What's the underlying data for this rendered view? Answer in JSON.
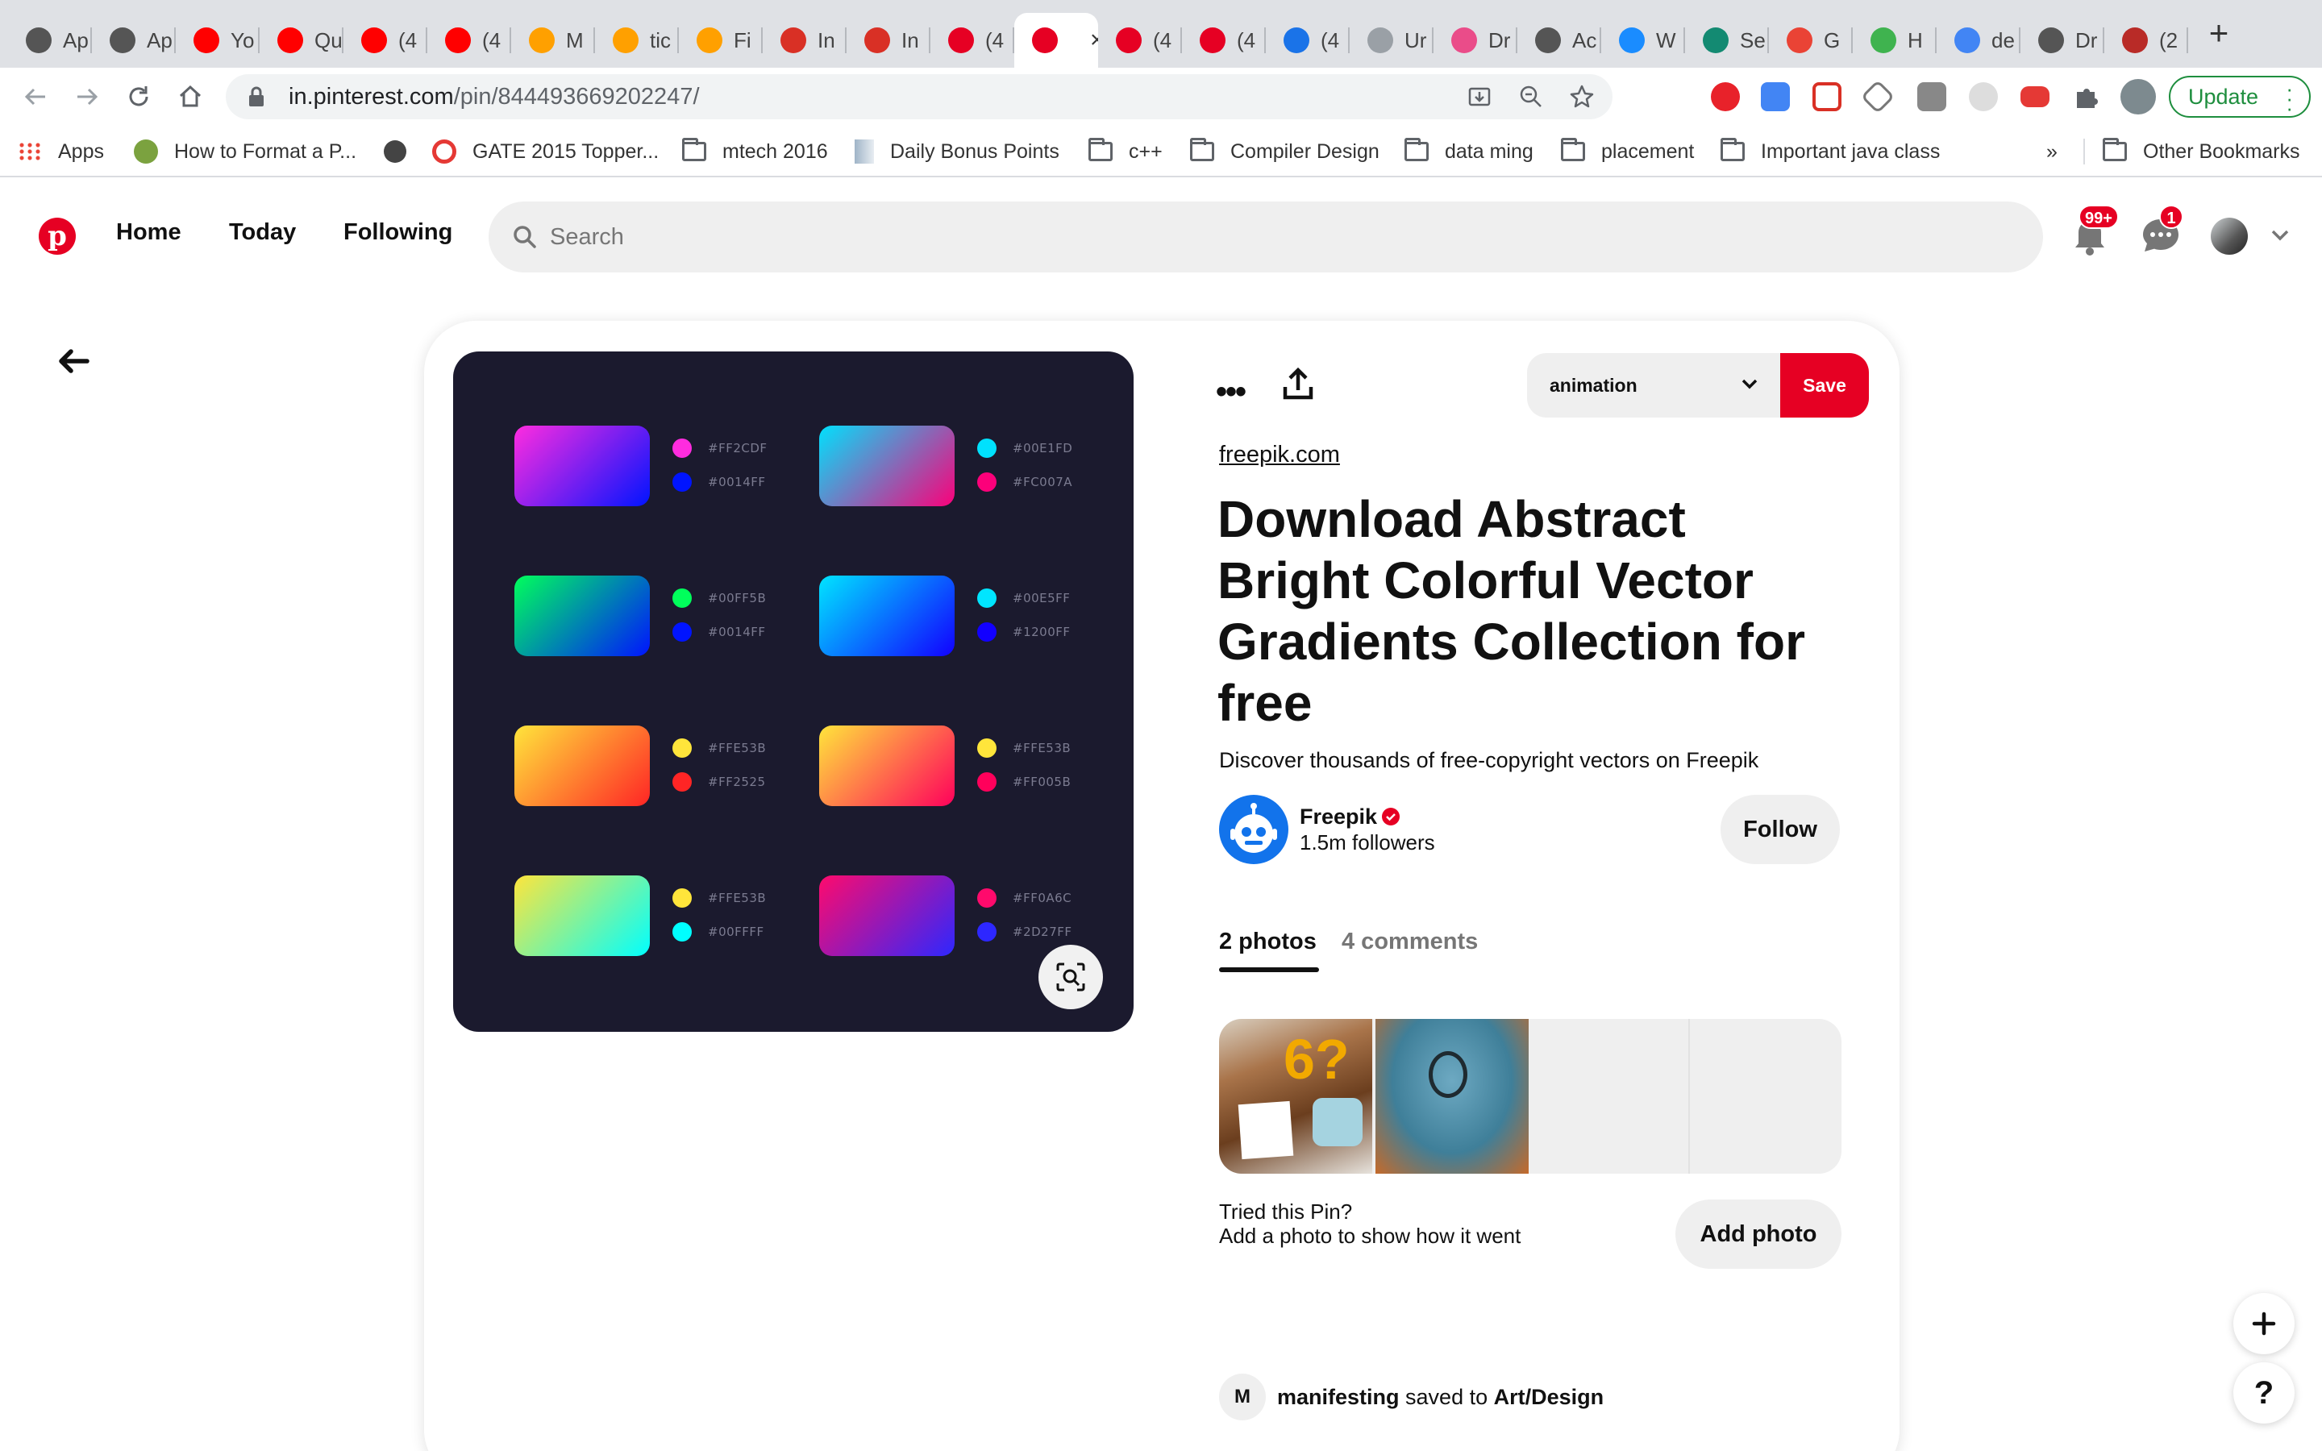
{
  "browser": {
    "tabs": [
      {
        "label": "Ap",
        "icon": "apple-icon",
        "color": "#555555"
      },
      {
        "label": "Ap",
        "icon": "apple-icon",
        "color": "#555555"
      },
      {
        "label": "Yo",
        "icon": "youtube-icon",
        "color": "#ff0000"
      },
      {
        "label": "Qu",
        "icon": "youtube-icon",
        "color": "#ff0000"
      },
      {
        "label": "(4",
        "icon": "youtube-icon",
        "color": "#ff0000"
      },
      {
        "label": "(4",
        "icon": "youtube-icon",
        "color": "#ff0000"
      },
      {
        "label": "M",
        "icon": "firebase-icon",
        "color": "#ffa000"
      },
      {
        "label": "tic",
        "icon": "firebase-icon",
        "color": "#ffa000"
      },
      {
        "label": "Fi",
        "icon": "firebase-icon",
        "color": "#ffa000"
      },
      {
        "label": "In",
        "icon": "gmail-icon",
        "color": "#d93025"
      },
      {
        "label": "In",
        "icon": "gmail-icon",
        "color": "#d93025"
      },
      {
        "label": "(4",
        "icon": "pinterest-icon",
        "color": "#e60023"
      },
      {
        "label": "",
        "icon": "pinterest-icon",
        "color": "#e60023",
        "active": true
      },
      {
        "label": "(4",
        "icon": "pinterest-icon",
        "color": "#e60023"
      },
      {
        "label": "(4",
        "icon": "pinterest-icon",
        "color": "#e60023"
      },
      {
        "label": "(4",
        "icon": "loading-icon",
        "color": "#1a73e8"
      },
      {
        "label": "Ur",
        "icon": "loading-icon",
        "color": "#9aa0a6"
      },
      {
        "label": "Dr",
        "icon": "dribbble-icon",
        "color": "#ea4c89"
      },
      {
        "label": "Ac",
        "icon": "fb-icon",
        "color": "#555555"
      },
      {
        "label": "W",
        "icon": "appstore-icon",
        "color": "#1a8cff"
      },
      {
        "label": "Se",
        "icon": "globe-icon",
        "color": "#138a72"
      },
      {
        "label": "G",
        "icon": "google-icon",
        "color": "#ea4335"
      },
      {
        "label": "H",
        "icon": "h-icon",
        "color": "#3fb34f"
      },
      {
        "label": "de",
        "icon": "google-icon",
        "color": "#4285f4"
      },
      {
        "label": "Dr",
        "icon": "apple-icon",
        "color": "#555555"
      },
      {
        "label": "(2",
        "icon": "quora-icon",
        "color": "#b92b27"
      }
    ],
    "url_domain": "in.pinterest.com",
    "url_path": "/pin/844493669202247/",
    "update_label": "Update",
    "bookmarks": [
      {
        "label": "Apps",
        "icon": "apps-grid-icon"
      },
      {
        "label": "How to Format a P...",
        "icon": "wh-icon"
      },
      {
        "label": "",
        "icon": "globe-icon"
      },
      {
        "label": "GATE 2015 Topper...",
        "icon": "gate-icon"
      },
      {
        "label": "mtech 2016",
        "icon": "folder-icon"
      },
      {
        "label": "Daily Bonus Points",
        "icon": "bonus-icon"
      },
      {
        "label": "c++",
        "icon": "folder-icon"
      },
      {
        "label": "Compiler Design",
        "icon": "folder-icon"
      },
      {
        "label": "data ming",
        "icon": "folder-icon"
      },
      {
        "label": "placement",
        "icon": "folder-icon"
      },
      {
        "label": "Important java class",
        "icon": "folder-icon"
      }
    ],
    "overflow_label": "»",
    "other_bookmarks": "Other Bookmarks"
  },
  "header": {
    "nav": [
      "Home",
      "Today",
      "Following"
    ],
    "search_placeholder": "Search",
    "notifications_badge": "99+",
    "messages_badge": "1"
  },
  "pin": {
    "gradients": [
      {
        "from": "#FF2CDF",
        "to": "#0014FF",
        "label_from": "#FF2CDF",
        "label_to": "#0014FF"
      },
      {
        "from": "#00E1FD",
        "to": "#FC007A",
        "label_from": "#00E1FD",
        "label_to": "#FC007A"
      },
      {
        "from": "#00FF5B",
        "to": "#0014FF",
        "label_from": "#00FF5B",
        "label_to": "#0014FF"
      },
      {
        "from": "#00E5FF",
        "to": "#1200FF",
        "label_from": "#00E5FF",
        "label_to": "#1200FF"
      },
      {
        "from": "#FFE53B",
        "to": "#FF2525",
        "label_from": "#FFE53B",
        "label_to": "#FF2525"
      },
      {
        "from": "#FFE53B",
        "to": "#FF005B",
        "label_from": "#FFE53B",
        "label_to": "#FF005B"
      },
      {
        "from": "#FFE53B",
        "to": "#00FFFF",
        "label_from": "#FFE53B",
        "label_to": "#00FFFF"
      },
      {
        "from": "#FF0A6C",
        "to": "#2D27FF",
        "label_from": "#FF0A6C",
        "label_to": "#2D27FF"
      }
    ],
    "board": "animation",
    "save_label": "Save",
    "source": "freepik.com",
    "title": "Download Abstract Bright Colorful Vector Gradients Collection for free",
    "description": "Discover thousands of free-copyright vectors on Freepik",
    "creator_name": "Freepik",
    "followers": "1.5m followers",
    "follow_label": "Follow",
    "tab_photos": "2 photos",
    "tab_comments": "4 comments",
    "tried_line1": "Tried this Pin?",
    "tried_line2": "Add a photo to show how it went",
    "add_photo_label": "Add photo",
    "saver_initial": "M",
    "saver_name": "manifesting",
    "saved_to_text": " saved to ",
    "saver_board": "Art/Design"
  },
  "colors": {
    "pinterest_red": "#e60023",
    "pin_background": "#1b1a2e",
    "update_green": "#1e8e3e"
  }
}
